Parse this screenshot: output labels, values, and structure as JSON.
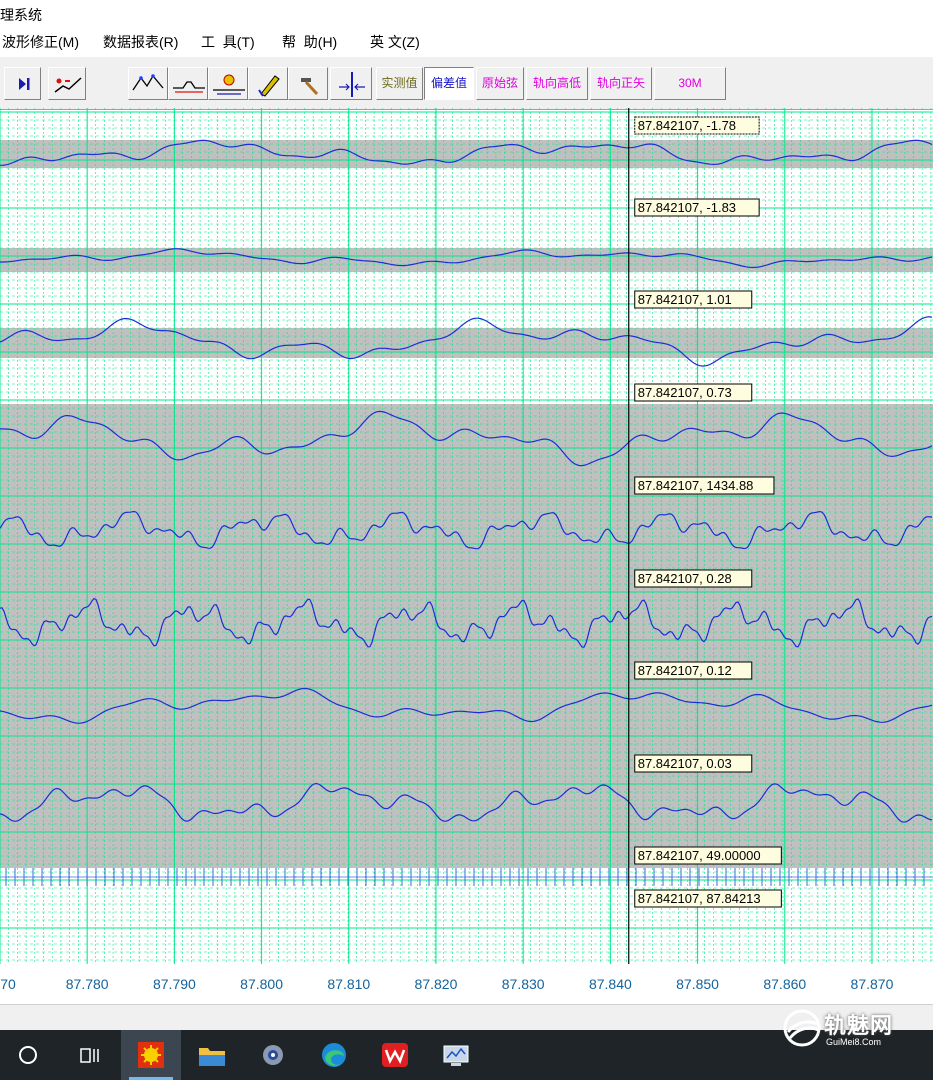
{
  "window": {
    "title": "理系统"
  },
  "menu": [
    "波形修正(M)",
    "数据报表(R)",
    "工  具(T)",
    "帮  助(H)",
    "英 文(Z)"
  ],
  "toolbar": {
    "buttons": [
      {
        "name": "skip-to-end-icon"
      },
      {
        "name": "waveform-edit-icon"
      },
      {
        "name": "peak-mark-icon"
      },
      {
        "name": "level-mark-icon"
      },
      {
        "name": "target-mark-icon"
      },
      {
        "name": "pen-tool-icon"
      },
      {
        "name": "hammer-tool-icon"
      },
      {
        "name": "cursor-line-icon"
      }
    ],
    "modes": [
      {
        "label": "实测值",
        "color": "#6b6b1c",
        "active": false
      },
      {
        "label": "偏差值",
        "color": "#1414c8",
        "active": true
      },
      {
        "label": "原始弦",
        "color": "#e000e0",
        "active": false
      },
      {
        "label": "轨向高低",
        "color": "#e000e0",
        "active": false
      },
      {
        "label": "轨向正矢",
        "color": "#e000e0",
        "active": false
      }
    ],
    "span_label": "30M"
  },
  "colors": {
    "grid": "#00e88a",
    "band": "#c0c0c0",
    "trace": "#1a2fd6",
    "cursor": "#000000",
    "label_bg": "#fffde0",
    "taskbar": "#1f2428"
  },
  "cursor_readouts": [
    "87.842107, -1.78",
    "87.842107, -1.83",
    "87.842107, 1.01",
    "87.842107, 0.73",
    "87.842107, 1434.88",
    "87.842107, 0.28",
    "87.842107, 0.12",
    "87.842107, 0.03",
    "87.842107, 49.00000",
    "87.842107, 87.84213"
  ],
  "chart_data": {
    "type": "line",
    "x_range": [
      87.77,
      87.877
    ],
    "cursor_x": 87.842107,
    "x_ticks": [
      "70",
      "87.780",
      "87.790",
      "87.800",
      "87.810",
      "87.820",
      "87.830",
      "87.840",
      "87.850",
      "87.860",
      "87.870"
    ],
    "channels": [
      {
        "value_at_cursor": -1.78
      },
      {
        "value_at_cursor": -1.83
      },
      {
        "value_at_cursor": 1.01
      },
      {
        "value_at_cursor": 0.73
      },
      {
        "value_at_cursor": 1434.88
      },
      {
        "value_at_cursor": 0.28
      },
      {
        "value_at_cursor": 0.12
      },
      {
        "value_at_cursor": 0.03
      },
      {
        "value_at_cursor": 49.0
      },
      {
        "value_at_cursor": 87.84213
      }
    ]
  },
  "taskbar": {
    "apps": [
      {
        "name": "start-search-icon",
        "active": false
      },
      {
        "name": "task-view-icon",
        "active": false
      },
      {
        "name": "track-app-icon",
        "active": true
      },
      {
        "name": "file-explorer-icon",
        "active": false
      },
      {
        "name": "settings-app-icon",
        "active": false
      },
      {
        "name": "edge-browser-icon",
        "active": false
      },
      {
        "name": "wps-office-icon",
        "active": false
      },
      {
        "name": "monitor-app-icon",
        "active": false
      }
    ]
  },
  "watermark": {
    "name": "轨魅网",
    "url": "GuiMei8.Com"
  }
}
